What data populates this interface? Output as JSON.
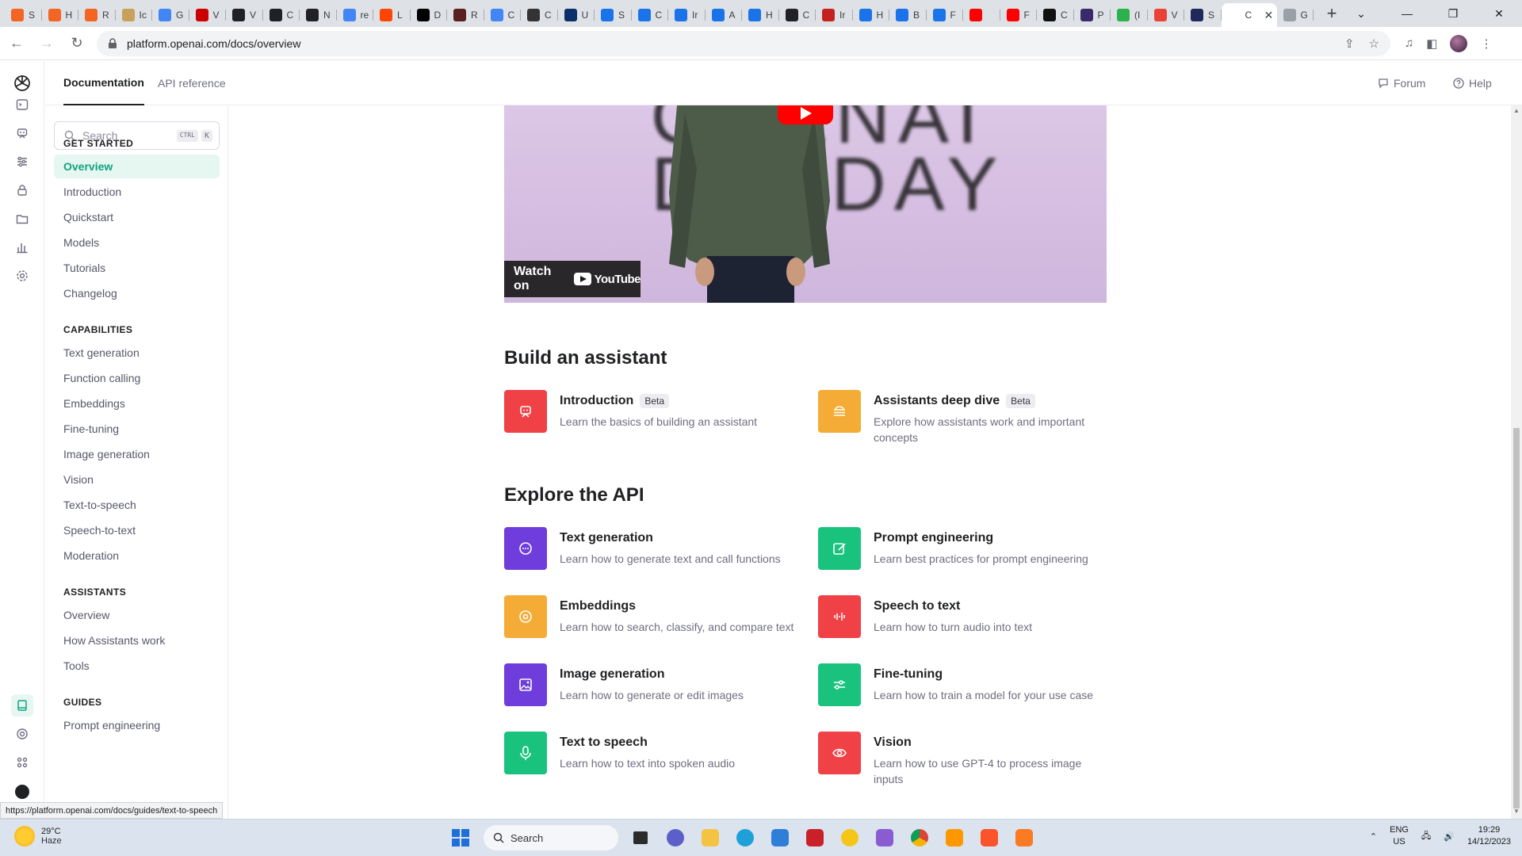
{
  "browser": {
    "tabs": [
      {
        "label": "S",
        "color": "#f26522"
      },
      {
        "label": "H",
        "color": "#f26522"
      },
      {
        "label": "R",
        "color": "#f26522"
      },
      {
        "label": "Ic",
        "color": "#c8a25a"
      },
      {
        "label": "G",
        "color": "#4285f4"
      },
      {
        "label": "V",
        "color": "#cc0000"
      },
      {
        "label": "V",
        "color": "#202124"
      },
      {
        "label": "C",
        "color": "#202124"
      },
      {
        "label": "N",
        "color": "#202124"
      },
      {
        "label": "re",
        "color": "#4285f4"
      },
      {
        "label": "L",
        "color": "#ff4500"
      },
      {
        "label": "D",
        "color": "#000000"
      },
      {
        "label": "R",
        "color": "#5a1f1f"
      },
      {
        "label": "C",
        "color": "#4285f4"
      },
      {
        "label": "C",
        "color": "#333333"
      },
      {
        "label": "U",
        "color": "#0b2f6b"
      },
      {
        "label": "S",
        "color": "#1a73e8"
      },
      {
        "label": "C",
        "color": "#1a73e8"
      },
      {
        "label": "Ir",
        "color": "#1a73e8"
      },
      {
        "label": "A",
        "color": "#1a73e8"
      },
      {
        "label": "H",
        "color": "#1a73e8"
      },
      {
        "label": "C",
        "color": "#202124"
      },
      {
        "label": "Ir",
        "color": "#c5221f"
      },
      {
        "label": "H",
        "color": "#1a73e8"
      },
      {
        "label": "B",
        "color": "#1a73e8"
      },
      {
        "label": "F",
        "color": "#1a73e8"
      },
      {
        "label": "",
        "color": "#ff0000"
      },
      {
        "label": "F",
        "color": "#ff0000"
      },
      {
        "label": "C",
        "color": "#111111"
      },
      {
        "label": "P",
        "color": "#3b2a6b"
      },
      {
        "label": "(I",
        "color": "#2bb24c"
      },
      {
        "label": "V",
        "color": "#ea4335"
      },
      {
        "label": "S",
        "color": "#1f2a5a"
      }
    ],
    "active_tab": {
      "label": "C"
    },
    "last_tab": {
      "label": "G"
    },
    "url": "platform.openai.com/docs/overview",
    "status_url": "https://platform.openai.com/docs/guides/text-to-speech"
  },
  "topnav": {
    "documentation": "Documentation",
    "api_reference": "API reference",
    "forum": "Forum",
    "help": "Help"
  },
  "sidebar": {
    "search_placeholder": "Search",
    "kbd_ctrl": "CTRL",
    "kbd_k": "K",
    "sections": [
      {
        "title": "GET STARTED",
        "items": [
          "Overview",
          "Introduction",
          "Quickstart",
          "Models",
          "Tutorials",
          "Changelog"
        ]
      },
      {
        "title": "CAPABILITIES",
        "items": [
          "Text generation",
          "Function calling",
          "Embeddings",
          "Fine-tuning",
          "Image generation",
          "Vision",
          "Text-to-speech",
          "Speech-to-text",
          "Moderation"
        ]
      },
      {
        "title": "ASSISTANTS",
        "items": [
          "Overview",
          "How Assistants work",
          "Tools"
        ]
      },
      {
        "title": "GUIDES",
        "items": [
          "Prompt engineering"
        ]
      }
    ]
  },
  "video": {
    "watch_on": "Watch on",
    "youtube": "YouTube",
    "bg_text_1": "OPENAI",
    "bg_text_2": "DEVDAY"
  },
  "build": {
    "heading": "Build an assistant",
    "cards": [
      {
        "title": "Introduction",
        "badge": "Beta",
        "desc": "Learn the basics of building an assistant",
        "color": "#ef4146",
        "icon": "robot-icon"
      },
      {
        "title": "Assistants deep dive",
        "badge": "Beta",
        "desc": "Explore how assistants work and important concepts",
        "color": "#f4ac36",
        "icon": "layers-icon"
      }
    ]
  },
  "explore": {
    "heading": "Explore the API",
    "cards": [
      {
        "title": "Text generation",
        "desc": "Learn how to generate text and call functions",
        "color": "#6e3ddb",
        "icon": "chat-bubble-icon"
      },
      {
        "title": "Prompt engineering",
        "desc": "Learn best practices for prompt engineering",
        "color": "#19c37d",
        "icon": "edit-icon"
      },
      {
        "title": "Embeddings",
        "desc": "Learn how to search, classify, and compare text",
        "color": "#f4ac36",
        "icon": "location-pin-icon"
      },
      {
        "title": "Speech to text",
        "desc": "Learn how to turn audio into text",
        "color": "#ef4146",
        "icon": "waveform-icon"
      },
      {
        "title": "Image generation",
        "desc": "Learn how to generate or edit images",
        "color": "#6e3ddb",
        "icon": "image-icon"
      },
      {
        "title": "Fine-tuning",
        "desc": "Learn how to train a model for your use case",
        "color": "#19c37d",
        "icon": "sliders-icon"
      },
      {
        "title": "Text to speech",
        "desc": "Learn how to text into spoken audio",
        "color": "#19c37d",
        "icon": "microphone-icon"
      },
      {
        "title": "Vision",
        "desc": "Learn how to use GPT-4 to process image inputs",
        "color": "#ef4146",
        "icon": "eye-icon"
      }
    ]
  },
  "taskbar": {
    "temp": "29°C",
    "weather": "Haze",
    "search": "Search",
    "lang": "ENG",
    "region": "US",
    "time": "19:29",
    "date": "14/12/2023"
  }
}
